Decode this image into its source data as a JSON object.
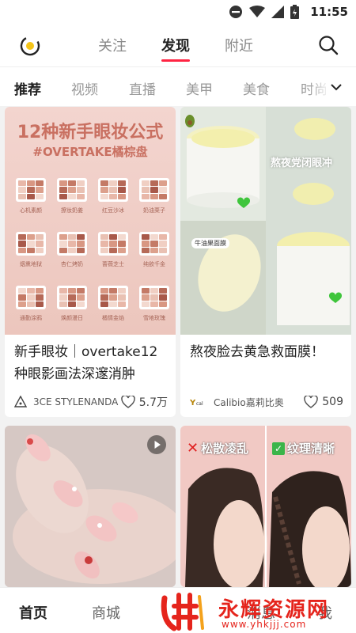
{
  "status_bar": {
    "time": "11:55"
  },
  "top_nav": {
    "tabs": [
      "关注",
      "发现",
      "附近"
    ],
    "active_tab": "发现"
  },
  "categories": {
    "items": [
      "推荐",
      "视频",
      "直播",
      "美甲",
      "美食",
      "时尚"
    ],
    "active": "推荐"
  },
  "feed": {
    "cards": [
      {
        "title": "新手眼妆｜overtake12种眼影画法深邃消肿",
        "author": "3CE STYLENANDA",
        "likes": "5.7万",
        "image_text": {
          "headline": "12种新手眼妆公式",
          "subheadline": "#OVERTAKE橘棕盘",
          "palette_labels": [
            "心机素颜",
            "撩妆奶姜",
            "红豆沙冰",
            "奶油栗子",
            "烟熏地狱",
            "杏仁烤奶",
            "蔷薇芝士",
            "纯欲千金",
            "通勤涂鸦",
            "焕颜漫日",
            "橘情金焰",
            "雪地玫瑰"
          ]
        }
      },
      {
        "title": "熬夜脸去黄急救面膜！",
        "author": "Calibio嘉莉比奥",
        "likes": "509",
        "image_text": {
          "tag1": "熬夜党闭眼冲",
          "tag2": "牛油果面膜"
        }
      },
      {
        "title": "",
        "author": "",
        "likes": "",
        "image_text": {}
      },
      {
        "title": "",
        "author": "",
        "likes": "",
        "image_text": {
          "left_label": "松散凌乱",
          "right_label": "纹理清晰"
        }
      }
    ]
  },
  "bottom_nav": {
    "items": [
      "首页",
      "商城",
      "消息",
      "我"
    ],
    "active": "首页"
  },
  "watermark": {
    "text": "永辉资源网",
    "url": "www.yhkjjj.com"
  },
  "colors": {
    "accent": "#ff2442",
    "watermark": "#e5241c"
  }
}
